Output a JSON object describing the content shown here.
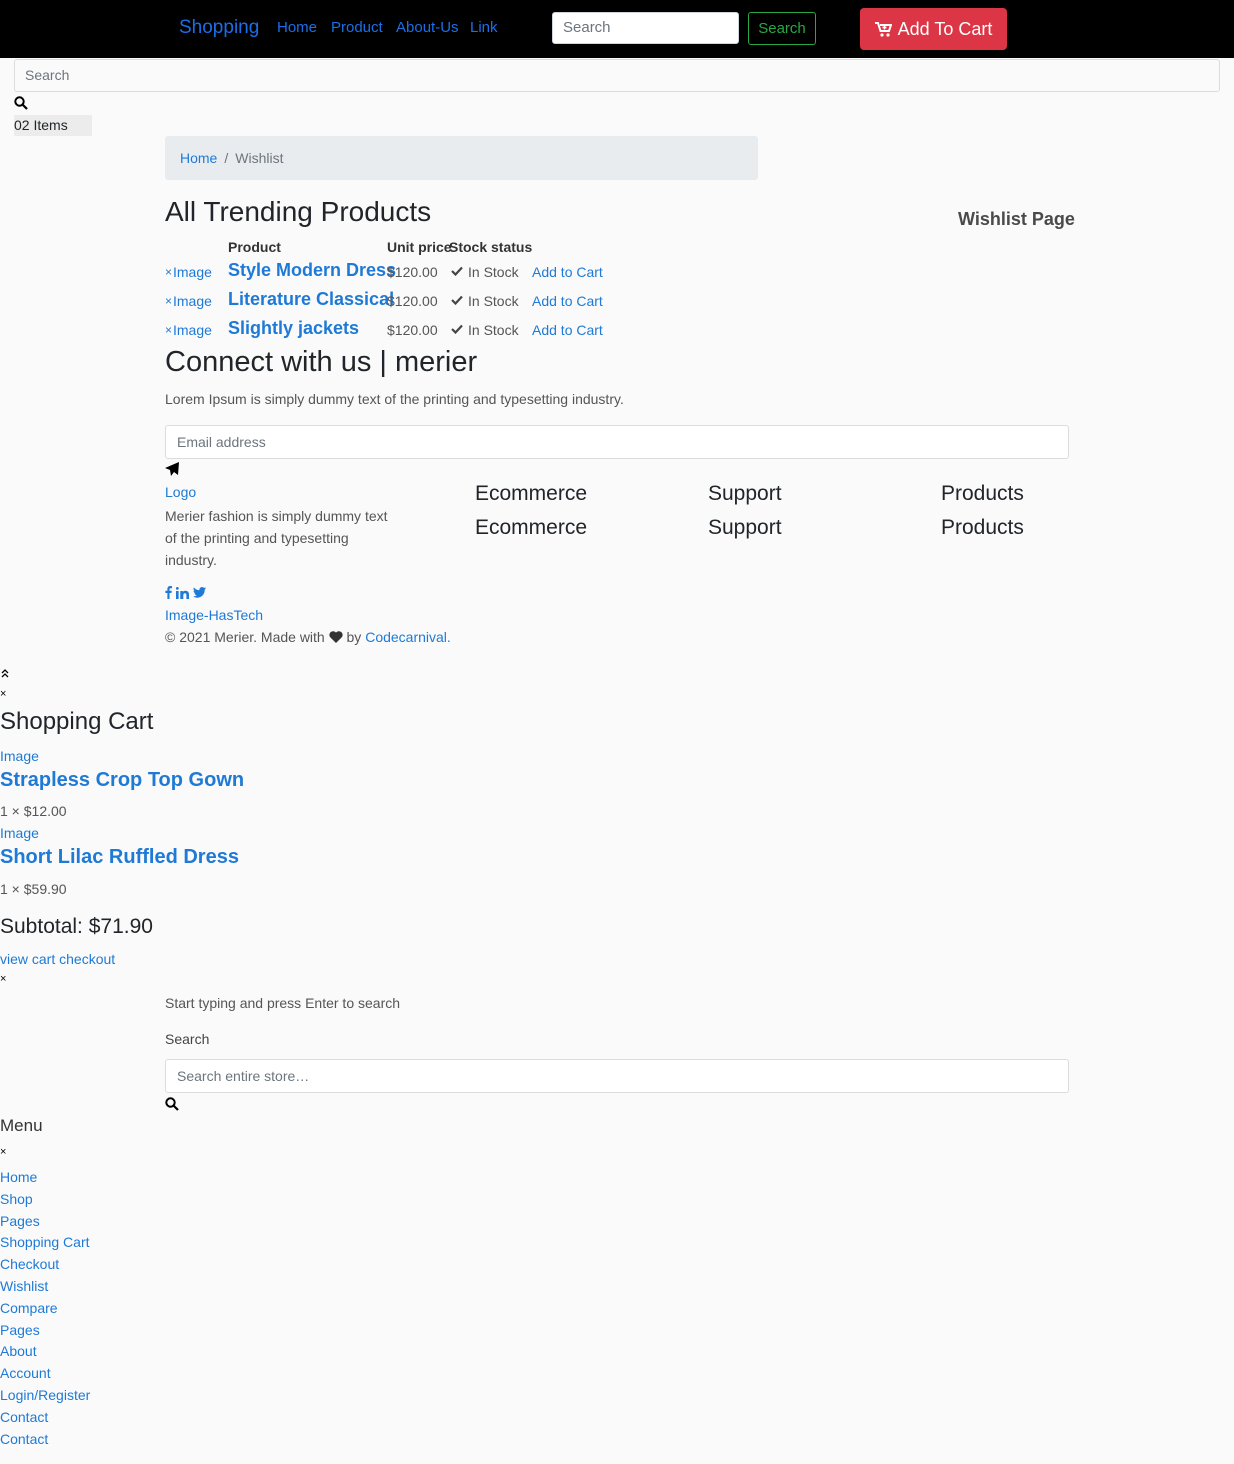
{
  "navbar": {
    "brand": "Shopping",
    "links": [
      "Home",
      "Product",
      "About-Us",
      "Link"
    ],
    "search_placeholder": "Search",
    "search_button": "Search",
    "cart_button": "Add To Cart"
  },
  "header": {
    "search_placeholder": "Search",
    "cart_count": "02 Items"
  },
  "breadcrumb": {
    "home": "Home",
    "sep": "/",
    "current": "Wishlist"
  },
  "page": {
    "title": "All Trending Products",
    "side_title": "Wishlist Page"
  },
  "wishlist": {
    "headers": {
      "product": "Product",
      "unit_price": "Unit price",
      "stock": "Stock status"
    },
    "rows": [
      {
        "remove": "×",
        "image": "Image",
        "name": "Style Modern Dress",
        "price": "$120.00",
        "stock": "In Stock",
        "action": "Add to Cart"
      },
      {
        "remove": "×",
        "image": "Image",
        "name": "Literature Classical",
        "price": "$120.00",
        "stock": "In Stock",
        "action": "Add to Cart"
      },
      {
        "remove": "×",
        "image": "Image",
        "name": "Slightly jackets",
        "price": "$120.00",
        "stock": "In Stock",
        "action": "Add to Cart"
      }
    ]
  },
  "newsletter": {
    "title": "Connect with us | merier",
    "text": "Lorem Ipsum is simply dummy text of the printing and typesetting industry.",
    "email_placeholder": "Email address"
  },
  "footer": {
    "logo": "Logo",
    "about": "Merier fashion is simply dummy text of the printing and typesetting industry.",
    "columns": [
      {
        "heading": "Ecommerce",
        "heading2": "Ecommerce"
      },
      {
        "heading": "Support",
        "heading2": "Support"
      },
      {
        "heading": "Products",
        "heading2": "Products"
      }
    ],
    "payment_image": "Image-HasTech",
    "copyright_prefix": "© 2021 Merier. Made with",
    "copyright_by": "by",
    "copyright_link": "Codecarnival."
  },
  "cart_offcanvas": {
    "close": "×",
    "title": "Shopping Cart",
    "items": [
      {
        "image": "Image",
        "name": "Strapless Crop Top Gown",
        "qty_price": "1 × $12.00"
      },
      {
        "image": "Image",
        "name": "Short Lilac Ruffled Dress",
        "qty_price": "1 × $59.90"
      }
    ],
    "subtotal": "Subtotal: $71.90",
    "links": "view cart checkout"
  },
  "search_overlay": {
    "close": "×",
    "hint": "Start typing and press Enter to search",
    "label": "Search",
    "placeholder": "Search entire store…"
  },
  "mobile_menu": {
    "title": "Menu",
    "close": "×",
    "items": [
      "Home",
      "Shop",
      "Pages",
      "Shopping Cart",
      "Checkout",
      "Wishlist",
      "Compare",
      "Pages",
      "About",
      "Account",
      "Login/Register",
      "Contact",
      "Contact"
    ]
  },
  "colors": {
    "navbar_bg": "#000000",
    "cart_button": "#dc3545",
    "link": "#1e7ad6",
    "nav_link": "#1a6fe8",
    "success": "#28a745"
  }
}
